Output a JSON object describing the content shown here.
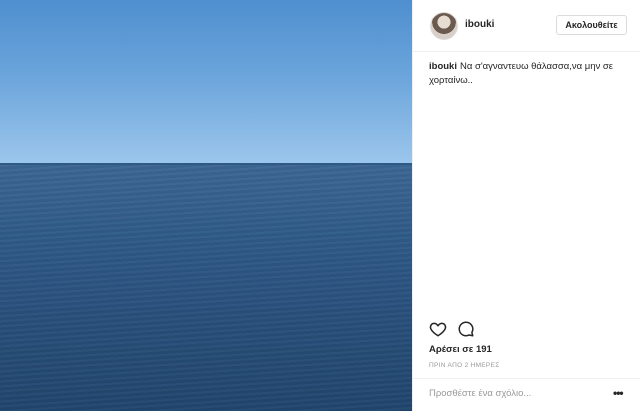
{
  "post": {
    "username": "ibouki",
    "follow_label": "Ακολουθείτε",
    "caption_user": "ibouki",
    "caption_text": "Να σ'αγναντευω θάλασσα,να μην σε χορταίνω..",
    "likes_text": "Αρέσει σε 191",
    "time_text": "ΠΡΙΝ ΑΠΟ 2 ΗΜΕΡΕΣ",
    "comment_placeholder": "Προσθέστε ένα σχόλιο...",
    "more_icon": "•••"
  },
  "icons": {
    "heart": "heart-icon",
    "comment": "comment-bubble-icon",
    "more": "more-options-icon"
  },
  "colors": {
    "sky": "#6aa4db",
    "sea": "#2f5a88",
    "text": "#262626",
    "muted": "#999999",
    "border": "#dbdbdb"
  }
}
